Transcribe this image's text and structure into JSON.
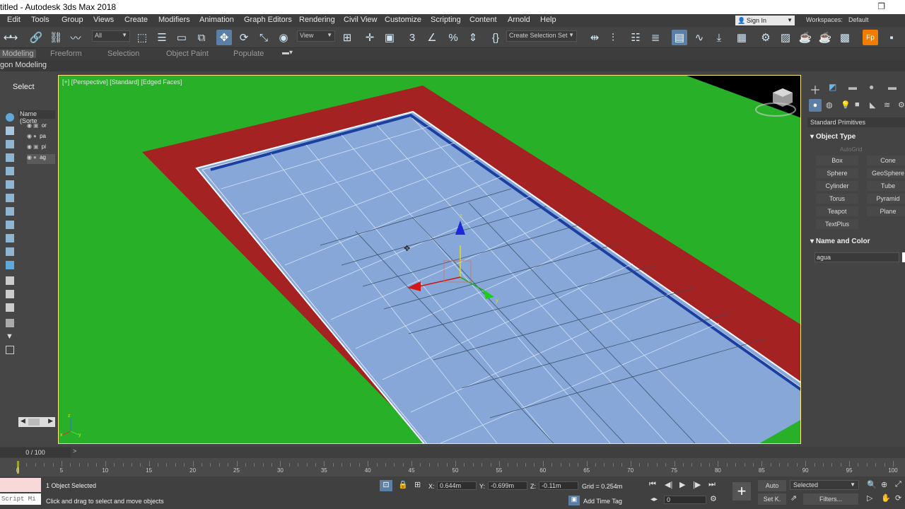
{
  "window": {
    "title": "titled - Autodesk 3ds Max 2018"
  },
  "menu": [
    "Edit",
    "Tools",
    "Group",
    "Views",
    "Create",
    "Modifiers",
    "Animation",
    "Graph Editors",
    "Rendering",
    "Civil View",
    "Customize",
    "Scripting",
    "Content",
    "Arnold",
    "Help"
  ],
  "account": {
    "sign_in": "Sign In",
    "workspaces_label": "Workspaces:",
    "workspace": "Default"
  },
  "toolbar": {
    "filter": "All",
    "view": "View",
    "selection_set": "Create Selection Set"
  },
  "ribbon": {
    "tabs": [
      "Modeling",
      "Freeform",
      "Selection",
      "Object Paint",
      "Populate"
    ],
    "sub": "gon Modeling"
  },
  "scene_explorer": {
    "select_label": "Select",
    "column_header": "Name (Sorte",
    "rows": [
      "or",
      "pa",
      "pi",
      "ag"
    ]
  },
  "viewport": {
    "label": "[+] [Perspective] [Standard] [Edged Faces]",
    "axis_x": "x",
    "axis_y": "y",
    "axis_z": "z"
  },
  "command_panel": {
    "category": "Standard Primitives",
    "object_type_title": "Object Type",
    "autogrid": "AutoGrid",
    "primitives": [
      "Box",
      "Cone",
      "Sphere",
      "GeoSphere",
      "Cylinder",
      "Tube",
      "Torus",
      "Pyramid",
      "Teapot",
      "Plane",
      "TextPlus"
    ],
    "name_color_title": "Name and Color",
    "object_name": "agua"
  },
  "timeline": {
    "frame": "0 / 100",
    "ticks": [
      "0",
      "5",
      "10",
      "15",
      "20",
      "25",
      "30",
      "35",
      "40",
      "45",
      "50",
      "55",
      "60",
      "65",
      "70",
      "75",
      "80",
      "85",
      "90",
      "95",
      "100"
    ]
  },
  "status": {
    "script": "Script Mi",
    "selected": "1 Object Selected",
    "prompt": "Click and drag to select and move objects",
    "x_label": "X:",
    "x": "0.644m",
    "y_label": "Y:",
    "y": "-0.699m",
    "z_label": "Z:",
    "z": "-0.11m",
    "grid": "Grid = 0.254m",
    "add_time_tag": "Add Time Tag",
    "auto": "Auto",
    "selected_dd": "Selected",
    "set_key": "Set K.",
    "filters": "Filters...",
    "frame_field": "0"
  }
}
